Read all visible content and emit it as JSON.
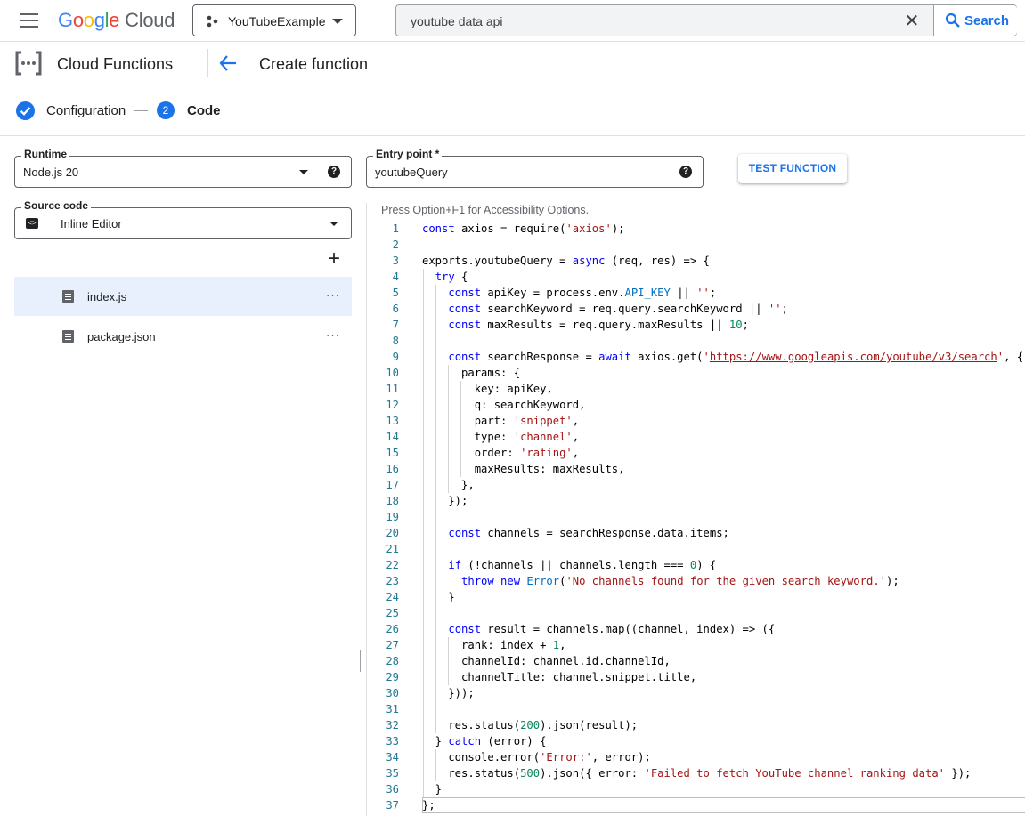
{
  "topbar": {
    "brand": [
      "G",
      "o",
      "o",
      "g",
      "l",
      "e"
    ],
    "brand_suffix": "Cloud",
    "project_name": "YouTubeExample",
    "search_query": "youtube data api",
    "search_button": "Search"
  },
  "header": {
    "product": "Cloud Functions",
    "page_title": "Create function"
  },
  "stepper": {
    "step1_label": "Configuration",
    "step2_number": "2",
    "step2_label": "Code"
  },
  "form": {
    "runtime_label": "Runtime",
    "runtime_value": "Node.js 20",
    "entry_point_label": "Entry point *",
    "entry_point_value": "youtubeQuery",
    "test_button": "TEST FUNCTION",
    "source_label": "Source code",
    "source_value": "Inline Editor",
    "help_glyph": "?",
    "add_glyph": "+",
    "more_glyph": "···"
  },
  "files": [
    {
      "name": "index.js",
      "active": true
    },
    {
      "name": "package.json",
      "active": false
    }
  ],
  "editor": {
    "a11y_hint": "Press Option+F1 for Accessibility Options.",
    "lines": [
      [
        [
          "k",
          "const"
        ],
        [
          "t",
          " axios = require("
        ],
        [
          "s",
          "'axios'"
        ],
        [
          "t",
          ");"
        ]
      ],
      [],
      [
        [
          "t",
          "exports.youtubeQuery = "
        ],
        [
          "k",
          "async"
        ],
        [
          "t",
          " (req, res) => {"
        ]
      ],
      [
        [
          "t",
          "  "
        ],
        [
          "k",
          "try"
        ],
        [
          "t",
          " {"
        ]
      ],
      [
        [
          "t",
          "    "
        ],
        [
          "k",
          "const"
        ],
        [
          "t",
          " apiKey = process.env."
        ],
        [
          "c",
          "API_KEY"
        ],
        [
          "t",
          " || "
        ],
        [
          "s",
          "''"
        ],
        [
          "t",
          ";"
        ]
      ],
      [
        [
          "t",
          "    "
        ],
        [
          "k",
          "const"
        ],
        [
          "t",
          " searchKeyword = req.query.searchKeyword || "
        ],
        [
          "s",
          "''"
        ],
        [
          "t",
          ";"
        ]
      ],
      [
        [
          "t",
          "    "
        ],
        [
          "k",
          "const"
        ],
        [
          "t",
          " maxResults = req.query.maxResults || "
        ],
        [
          "n",
          "10"
        ],
        [
          "t",
          ";"
        ]
      ],
      [],
      [
        [
          "t",
          "    "
        ],
        [
          "k",
          "const"
        ],
        [
          "t",
          " searchResponse = "
        ],
        [
          "k",
          "await"
        ],
        [
          "t",
          " axios.get("
        ],
        [
          "s",
          "'"
        ],
        [
          "u",
          "https://www.googleapis.com/youtube/v3/search"
        ],
        [
          "s",
          "'"
        ],
        [
          "t",
          ", {"
        ]
      ],
      [
        [
          "t",
          "      params: {"
        ]
      ],
      [
        [
          "t",
          "        key: apiKey,"
        ]
      ],
      [
        [
          "t",
          "        q: searchKeyword,"
        ]
      ],
      [
        [
          "t",
          "        part: "
        ],
        [
          "s",
          "'snippet'"
        ],
        [
          "t",
          ","
        ]
      ],
      [
        [
          "t",
          "        type: "
        ],
        [
          "s",
          "'channel'"
        ],
        [
          "t",
          ","
        ]
      ],
      [
        [
          "t",
          "        order: "
        ],
        [
          "s",
          "'rating'"
        ],
        [
          "t",
          ","
        ]
      ],
      [
        [
          "t",
          "        maxResults: maxResults,"
        ]
      ],
      [
        [
          "t",
          "      },"
        ]
      ],
      [
        [
          "t",
          "    });"
        ]
      ],
      [],
      [
        [
          "t",
          "    "
        ],
        [
          "k",
          "const"
        ],
        [
          "t",
          " channels = searchResponse.data.items;"
        ]
      ],
      [],
      [
        [
          "t",
          "    "
        ],
        [
          "k",
          "if"
        ],
        [
          "t",
          " (!channels || channels.length === "
        ],
        [
          "n",
          "0"
        ],
        [
          "t",
          ") {"
        ]
      ],
      [
        [
          "t",
          "      "
        ],
        [
          "k",
          "throw new"
        ],
        [
          "t",
          " "
        ],
        [
          "c",
          "Error"
        ],
        [
          "t",
          "("
        ],
        [
          "s",
          "'No channels found for the given search keyword.'"
        ],
        [
          "t",
          ");"
        ]
      ],
      [
        [
          "t",
          "    }"
        ]
      ],
      [],
      [
        [
          "t",
          "    "
        ],
        [
          "k",
          "const"
        ],
        [
          "t",
          " result = channels.map((channel, index) => ({"
        ]
      ],
      [
        [
          "t",
          "      rank: index + "
        ],
        [
          "n",
          "1"
        ],
        [
          "t",
          ","
        ]
      ],
      [
        [
          "t",
          "      channelId: channel.id.channelId,"
        ]
      ],
      [
        [
          "t",
          "      channelTitle: channel.snippet.title,"
        ]
      ],
      [
        [
          "t",
          "    }));"
        ]
      ],
      [],
      [
        [
          "t",
          "    res.status("
        ],
        [
          "n",
          "200"
        ],
        [
          "t",
          ").json(result);"
        ]
      ],
      [
        [
          "t",
          "  } "
        ],
        [
          "k",
          "catch"
        ],
        [
          "t",
          " (error) {"
        ]
      ],
      [
        [
          "t",
          "    console.error("
        ],
        [
          "s",
          "'Error:'"
        ],
        [
          "t",
          ", error);"
        ]
      ],
      [
        [
          "t",
          "    res.status("
        ],
        [
          "n",
          "500"
        ],
        [
          "t",
          ").json({ error: "
        ],
        [
          "s",
          "'Failed to fetch YouTube channel ranking data'"
        ],
        [
          "t",
          " });"
        ]
      ],
      [
        [
          "t",
          "  }"
        ]
      ],
      [
        [
          "t",
          "};"
        ]
      ]
    ]
  },
  "colors": {
    "accent": "#1a73e8",
    "keyword": "#0000ff",
    "string": "#a31515",
    "number": "#098658",
    "line_number": "#237893"
  }
}
